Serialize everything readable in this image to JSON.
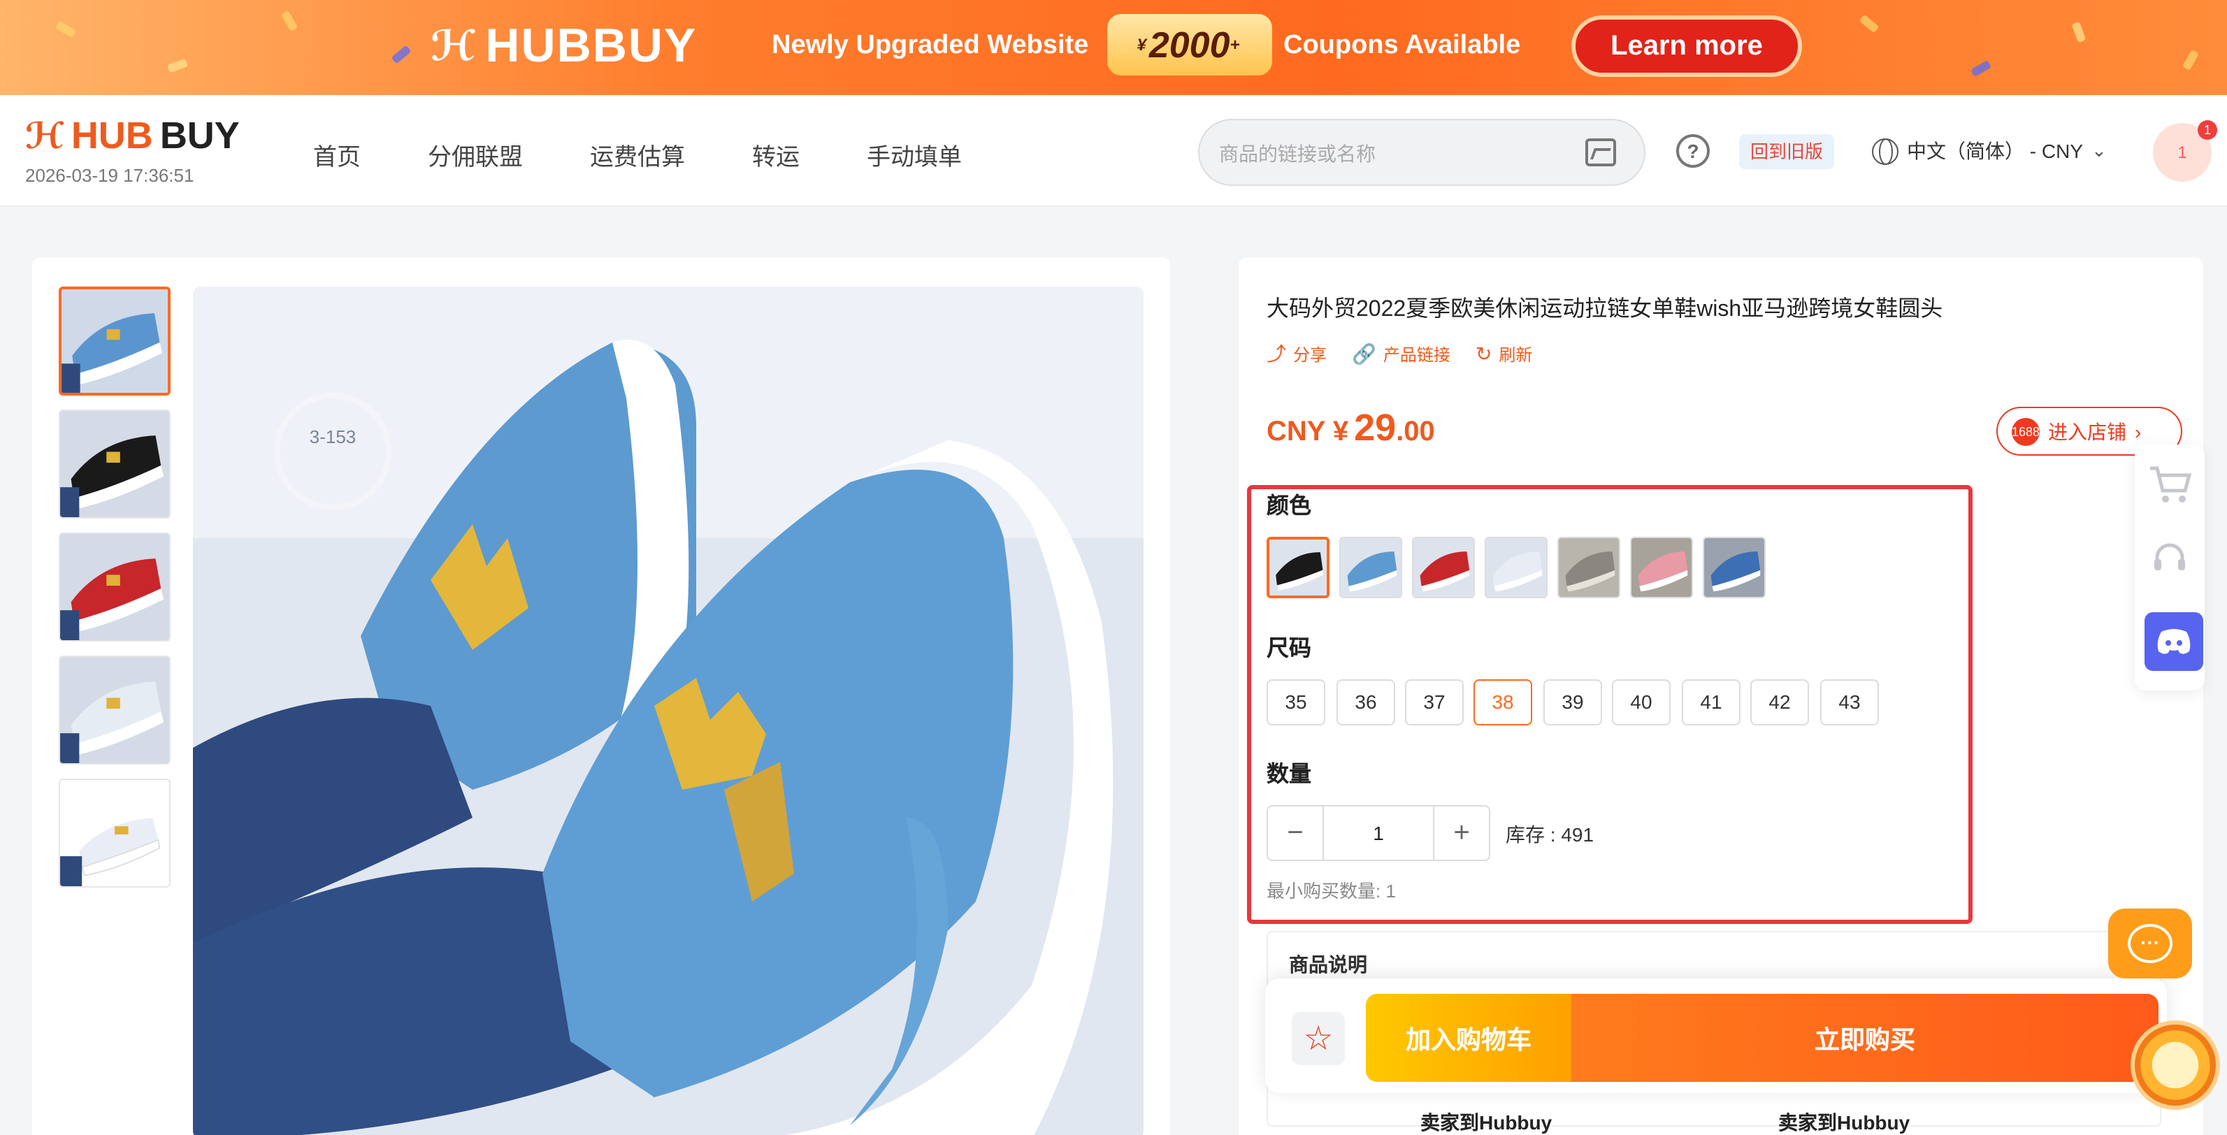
{
  "banner": {
    "brand": "HUBBUY",
    "text_left": "Newly Upgraded Website",
    "amount_prefix": "¥",
    "amount": "2000",
    "amount_suffix": "+",
    "text_right": "Coupons Available",
    "cta": "Learn more"
  },
  "header": {
    "logo_hub": "HUB",
    "logo_buy": "BUY",
    "datetime": "2026-03-19 17:36:51",
    "nav": [
      "首页",
      "分佣联盟",
      "运费估算",
      "转运",
      "手动填单"
    ],
    "search_placeholder": "商品的链接或名称",
    "help_symbol": "?",
    "old_version": "回到旧版",
    "language": "中文（简体） - CNY",
    "avatar_text": "1",
    "badge": "1"
  },
  "product": {
    "title": "大码外贸2022夏季欧美休闲运动拉链女单鞋wish亚马逊跨境女鞋圆头",
    "actions": [
      {
        "icon": "share-icon",
        "label": "分享"
      },
      {
        "icon": "link-icon",
        "label": "产品链接"
      },
      {
        "icon": "refresh-icon",
        "label": "刷新"
      }
    ],
    "price_currency": "CNY ¥",
    "price_int": "29",
    "price_dec": ".00",
    "store_button": "进入店铺",
    "store_badge": "1688",
    "color_label": "颜色",
    "size_label": "尺码",
    "sizes": [
      "35",
      "36",
      "37",
      "38",
      "39",
      "40",
      "41",
      "42",
      "43"
    ],
    "selected_size": "38",
    "quantity_label": "数量",
    "quantity": "1",
    "qty_minus": "−",
    "qty_plus": "+",
    "stock": "库存 : 491",
    "min_buy": "最小购买数量: 1",
    "description": "商品说明",
    "add_to_cart": "加入购物车",
    "buy_now": "立即购买",
    "seller_label_1": "卖家到Hubbuy",
    "seller_label_2": "卖家到Hubbuy"
  },
  "main_image_label": "3-153",
  "colors": {
    "brand_orange": "#ee5a1e",
    "highlight_red": "#e8373d",
    "discord": "#5664f0"
  }
}
